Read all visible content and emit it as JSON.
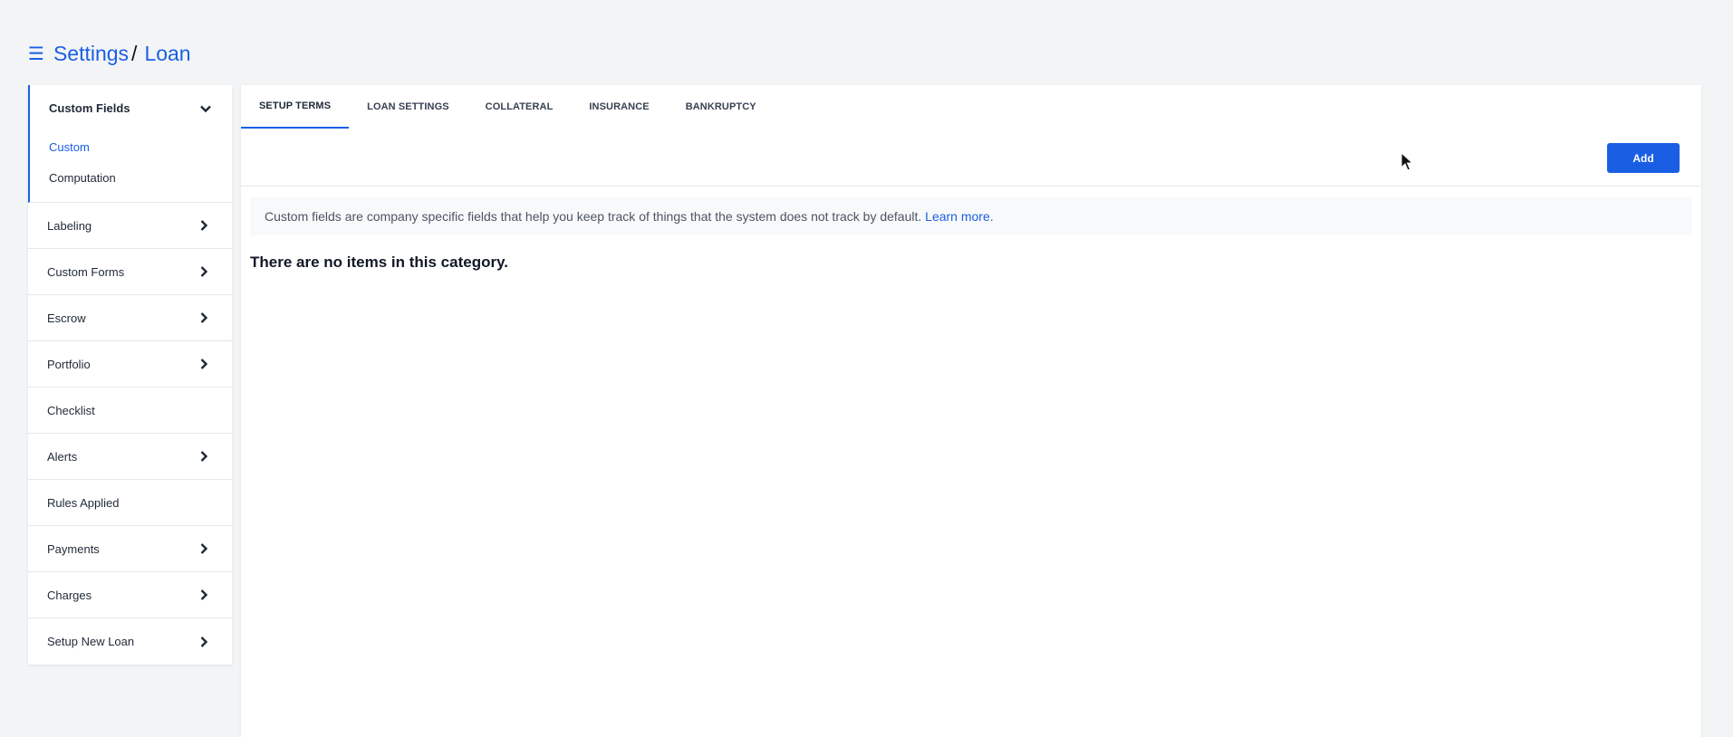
{
  "breadcrumb": {
    "menu_icon": "☰",
    "root": "Settings",
    "separator": "/",
    "current": "Loan"
  },
  "sidebar": {
    "open_group": {
      "label": "Custom Fields",
      "icon": "chevron-down-icon",
      "children": [
        {
          "label": "Custom",
          "active": true
        },
        {
          "label": "Computation",
          "active": false
        }
      ]
    },
    "items": [
      {
        "label": "Labeling",
        "has_chevron": true
      },
      {
        "label": "Custom Forms",
        "has_chevron": true
      },
      {
        "label": "Escrow",
        "has_chevron": true
      },
      {
        "label": "Portfolio",
        "has_chevron": true
      },
      {
        "label": "Checklist",
        "has_chevron": false
      },
      {
        "label": "Alerts",
        "has_chevron": true
      },
      {
        "label": "Rules Applied",
        "has_chevron": false
      },
      {
        "label": "Payments",
        "has_chevron": true
      },
      {
        "label": "Charges",
        "has_chevron": true
      },
      {
        "label": "Setup New Loan",
        "has_chevron": true
      }
    ]
  },
  "tabs": [
    {
      "label": "SETUP TERMS",
      "active": true
    },
    {
      "label": "LOAN SETTINGS",
      "active": false
    },
    {
      "label": "COLLATERAL",
      "active": false
    },
    {
      "label": "INSURANCE",
      "active": false
    },
    {
      "label": "BANKRUPTCY",
      "active": false
    }
  ],
  "toolbar": {
    "add_label": "Add"
  },
  "info": {
    "text": "Custom fields are company specific fields that help you keep track of things that the system does not track by default.",
    "link": "Learn more",
    "suffix": "."
  },
  "empty_message": "There are no items in this category.",
  "colors": {
    "accent": "#1a5fe3",
    "background": "#f3f4f6"
  }
}
